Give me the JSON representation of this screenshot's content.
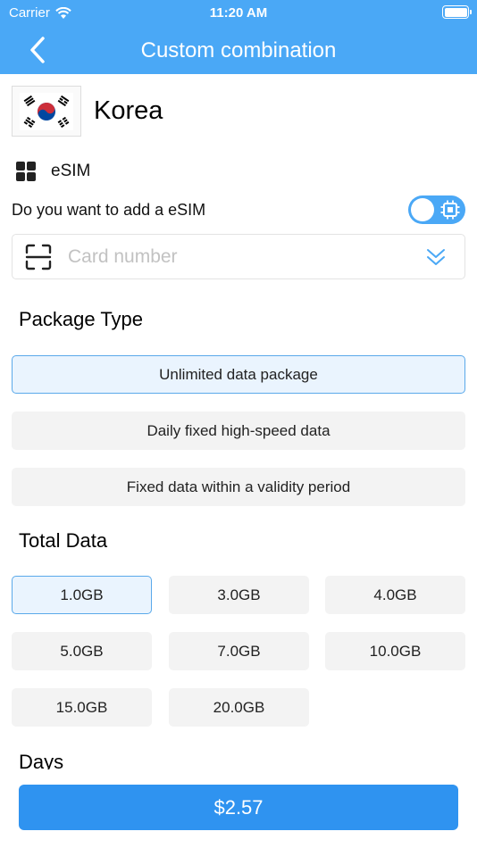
{
  "status": {
    "carrier": "Carrier",
    "time": "11:20 AM"
  },
  "nav": {
    "title": "Custom combination"
  },
  "country": {
    "name": "Korea"
  },
  "esim": {
    "label": "eSIM",
    "add_question": "Do you want to add a eSIM",
    "toggle_on": true
  },
  "card": {
    "placeholder": "Card number",
    "value": ""
  },
  "package": {
    "title": "Package Type",
    "options": [
      "Unlimited data package",
      "Daily fixed high-speed data",
      "Fixed data within a validity period"
    ],
    "selected": "Unlimited data package"
  },
  "data": {
    "title": "Total Data",
    "options": [
      "1.0GB",
      "3.0GB",
      "4.0GB",
      "5.0GB",
      "7.0GB",
      "10.0GB",
      "15.0GB",
      "20.0GB"
    ],
    "selected": "1.0GB"
  },
  "days": {
    "title": "Days"
  },
  "footer": {
    "price": "$2.57"
  },
  "colors": {
    "header": "#4aa8f6",
    "button": "#2f93f0",
    "selected_bg": "#eaf4fe",
    "selected_border": "#5aa9ea"
  }
}
